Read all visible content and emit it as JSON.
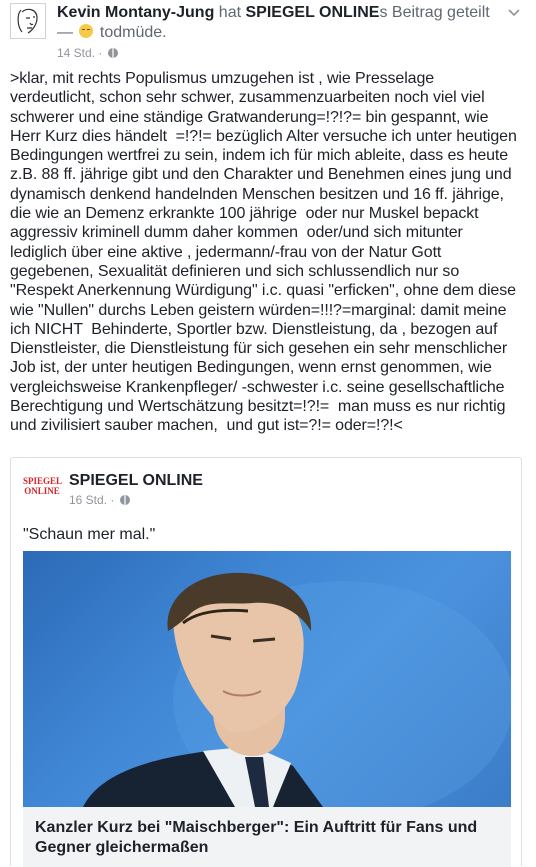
{
  "post": {
    "author": "Kevin Montany-Jung",
    "action": "hat",
    "shared_page": "SPIEGEL ONLINE",
    "shared_suffix": "s Beitrag geteilt",
    "feeling_prefix": "—",
    "feeling": "todmüde.",
    "time": "14 Std. ·",
    "body": ">klar, mit rechts Populismus umzugehen ist , wie Presselage verdeutlicht, schon sehr schwer, zusammenzuarbeiten noch viel viel schwerer und eine ständige Gratwanderung=!?!?= bin gespannt, wie Herr Kurz dies händelt  =!?!= bezüglich Alter versuche ich unter heutigen Bedingungen wertfrei zu sein, indem ich für mich ableite, dass es heute z.B. 88 ff. jährige gibt und den Charakter und Benehmen eines jung und dynamisch denkend handelnden Menschen besitzen und 16 ff. jährige, die wie an Demenz erkrankte 100 jährige  oder nur Muskel bepackt aggressiv kriminell dumm daher kommen  oder/und sich mitunter lediglich über eine aktive , jedermann/-frau von der Natur Gott gegebenen, Sexualität definieren und sich schlussendlich nur so \"Respekt Anerkennung Würdigung\" i.c. quasi \"erficken\", ohne dem diese wie \"Nullen\" durchs Leben geistern würden=!!!?=marginal: damit meine ich NICHT  Behinderte, Sportler bzw. Dienstleistung, da , bezogen auf Dienstleister, die Dienstleistung für sich gesehen ein sehr menschlicher Job ist, der unter heutigen Bedingungen, wenn ernst genommen, wie vergleichsweise Krankenpfleger/ -schwester i.c. seine gesellschaftliche Berechtigung und Wertschätzung besitzt=!?!=  man muss es nur richtig und zivilisiert sauber machen,  und gut ist=?!= oder=!?!<"
  },
  "shared": {
    "page_logo_line1": "SPIEGEL",
    "page_logo_line2": "ONLINE",
    "page_name": "SPIEGEL ONLINE",
    "time": "16 Std. ·",
    "text": "\"Schaun mer mal.\"",
    "link_title": "Kanzler Kurz bei \"Maischberger\": Ein Auftritt für Fans und Gegner gleichermaßen"
  },
  "icons": {
    "avatar": "line-drawing-portrait",
    "menu": "chevron-down-icon",
    "privacy": "globe-icon",
    "feeling": "sleepy-face-emoji"
  },
  "colors": {
    "text": "#1d2129",
    "secondary": "#606770",
    "meta": "#90949c",
    "spiegel_red": "#d8232a",
    "image_background": "#3f86d4",
    "caption_background": "#f2f3f5"
  }
}
